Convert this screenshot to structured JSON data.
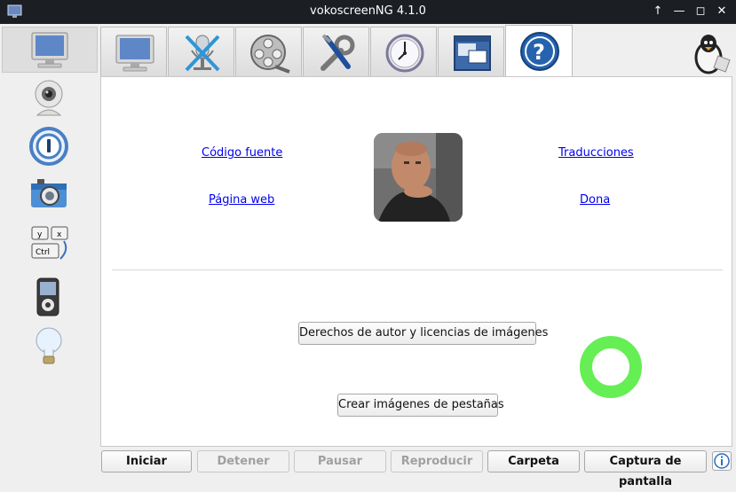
{
  "window": {
    "title": "vokoscreenNG 4.1.0"
  },
  "window_controls": [
    {
      "name": "maximize-arrow-icon",
      "glyph": "↑"
    },
    {
      "name": "minimize-icon",
      "glyph": "—"
    },
    {
      "name": "restore-icon",
      "glyph": "◻"
    },
    {
      "name": "close-icon",
      "glyph": "✕"
    }
  ],
  "sidebar": {
    "items": [
      {
        "name": "screencast-icon"
      },
      {
        "name": "webcam-icon"
      },
      {
        "name": "magnifier-icon"
      },
      {
        "name": "camera-icon"
      },
      {
        "name": "keyboard-icon"
      },
      {
        "name": "player-icon"
      },
      {
        "name": "lightbulb-icon"
      }
    ]
  },
  "tabs": [
    {
      "name": "monitor-icon"
    },
    {
      "name": "microphone-muted-icon"
    },
    {
      "name": "film-reel-icon"
    },
    {
      "name": "tools-icon"
    },
    {
      "name": "clock-icon"
    },
    {
      "name": "window-icon"
    },
    {
      "name": "help-icon"
    }
  ],
  "about": {
    "source_link": "Código fuente",
    "translations_link": "Traducciones",
    "website_link": "Página web",
    "donate_link": "Dona",
    "copyright_button": "Derechos de autor y licencias de imágenes",
    "tab_images_button": "Crear imágenes de pestañas"
  },
  "ring_color": "#66ee55",
  "bottom": {
    "start": "Iniciar",
    "stop": "Detener",
    "pause": "Pausar",
    "play": "Reproducir",
    "folder": "Carpeta",
    "screenshot": "Captura de pantalla"
  }
}
